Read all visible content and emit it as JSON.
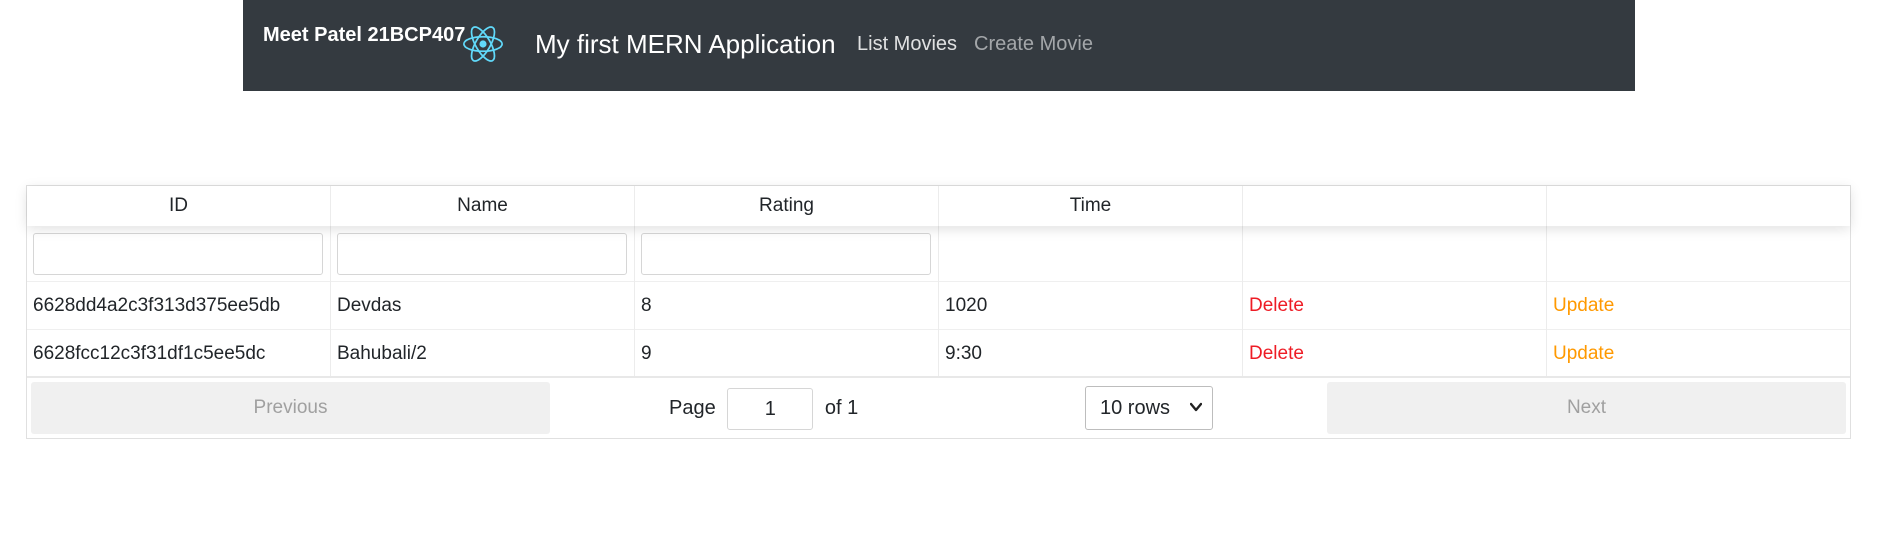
{
  "navbar": {
    "brand": "Meet Patel 21BCP407",
    "logo_icon": "react-atom-icon",
    "logo_color": "#61dafb",
    "app_title": "My first MERN Application",
    "links": [
      {
        "label": "List Movies",
        "active": true
      },
      {
        "label": "Create Movie",
        "active": false
      }
    ],
    "background": "#343a40"
  },
  "table": {
    "columns": [
      "ID",
      "Name",
      "Rating",
      "Time",
      "",
      ""
    ],
    "rows": [
      {
        "id": "6628dd4a2c3f313d375ee5db",
        "name": "Devdas",
        "rating": "8",
        "time": "1020",
        "delete": "Delete",
        "update": "Update"
      },
      {
        "id": "6628fcc12c3f31df1c5ee5dc",
        "name": "Bahubali/2",
        "rating": "9",
        "time": "9:30",
        "delete": "Delete",
        "update": "Update"
      }
    ],
    "filters": {
      "id": "",
      "name": "",
      "rating": ""
    },
    "action_colors": {
      "delete": "#ee1c25",
      "update": "#ff9900"
    }
  },
  "pagination": {
    "previous_label": "Previous",
    "next_label": "Next",
    "page_label": "Page",
    "current_page": "1",
    "of_label": "of 1",
    "rows_option": "10 rows",
    "chevron_icon": "chevron-down-icon"
  }
}
